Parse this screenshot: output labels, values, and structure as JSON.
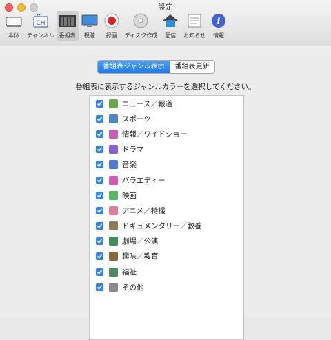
{
  "window": {
    "title": "設定"
  },
  "toolbar": {
    "items": [
      {
        "label": "本体",
        "icon": "device-icon"
      },
      {
        "label": "チャンネル",
        "icon": "channel-icon"
      },
      {
        "label": "番組表",
        "icon": "program-guide-icon",
        "selected": true
      },
      {
        "label": "視聴",
        "icon": "monitor-icon"
      },
      {
        "label": "録画",
        "icon": "record-icon"
      },
      {
        "label": "ディスク作成",
        "icon": "disc-icon"
      },
      {
        "label": "配信",
        "icon": "home-icon"
      },
      {
        "label": "お知らせ",
        "icon": "notice-icon"
      },
      {
        "label": "情報",
        "icon": "info-icon"
      }
    ]
  },
  "segmented": {
    "tab1": "番組表ジャンル表示",
    "tab2": "番組表更新"
  },
  "instruction": "番組表に表示するジャンルカラーを選択してください。",
  "genres": [
    {
      "label": "ニュース／報道",
      "color": "#6aa84f"
    },
    {
      "label": "スポーツ",
      "color": "#4c86c6"
    },
    {
      "label": "情報／ワイドショー",
      "color": "#c85fb4"
    },
    {
      "label": "ドラマ",
      "color": "#8b5fd6"
    },
    {
      "label": "音楽",
      "color": "#4b7bd6"
    },
    {
      "label": "バラエティー",
      "color": "#d65ab4"
    },
    {
      "label": "映画",
      "color": "#58b85e"
    },
    {
      "label": "アニメ／特撮",
      "color": "#e07e9a"
    },
    {
      "label": "ドキュメンタリー／教養",
      "color": "#8f7a5a"
    },
    {
      "label": "劇場／公演",
      "color": "#3f8f5a"
    },
    {
      "label": "趣味／教育",
      "color": "#8a6a3a"
    },
    {
      "label": "福祉",
      "color": "#4d8a5a"
    },
    {
      "label": "その他",
      "color": "#8a8a8a"
    }
  ],
  "accent": "#2f86f0"
}
